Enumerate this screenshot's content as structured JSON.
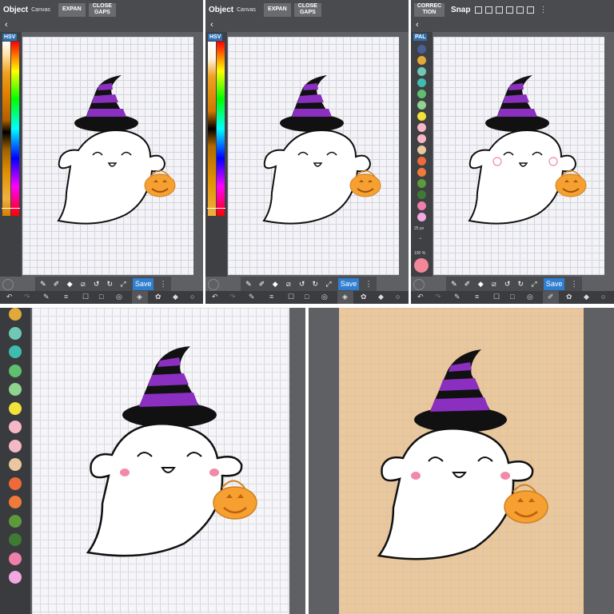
{
  "panels": [
    {
      "id": "panel-1",
      "topbar": {
        "mode": "Object",
        "sub": "Canvas",
        "btn1": "EXPAN",
        "btn2": "CLOSE GAPS"
      },
      "sidebar_tag": "HSV",
      "save_label": "Save"
    },
    {
      "id": "panel-2",
      "topbar": {
        "mode": "Object",
        "sub": "Canvas",
        "btn1": "EXPAN",
        "btn2": "CLOSE GAPS"
      },
      "sidebar_tag": "HSV",
      "save_label": "Save"
    },
    {
      "id": "panel-3",
      "topbar": {
        "mode": "CORREC TION",
        "snap": "Snap"
      },
      "sidebar_tag": "PAL",
      "brush_size": "25 px",
      "opacity": "100 %",
      "save_label": "Save"
    }
  ],
  "palette_colors": [
    "#e0a93a",
    "#6fc7b6",
    "#3fbcb0",
    "#5fbf6f",
    "#8fd38f",
    "#f2e23a",
    "#f4b8c6",
    "#f4b8c6",
    "#e9c7a0",
    "#ee6a3a",
    "#f07a3a",
    "#5c9a3a",
    "#3e7a34",
    "#f07eaa",
    "#f2a8e0"
  ],
  "palette_colors_small": [
    "#4b5e96",
    "#e0a93a",
    "#6fc7b6",
    "#3fbcb0",
    "#5fbf6f",
    "#8fd38f",
    "#f2e23a",
    "#f4b8c6",
    "#f4b8c6",
    "#e9c7a0",
    "#ee6a3a",
    "#f07a3a",
    "#5c9a3a",
    "#3e7a34",
    "#f07eaa",
    "#f2a8e0"
  ],
  "colors": {
    "hat_black": "#111111",
    "hat_purple": "#8a2fc0",
    "ghost_white": "#ffffff",
    "blush": "#f08aa8",
    "pumpkin": "#f5a030",
    "tan_background": "#ebc898",
    "accent_blue": "#2f7fd0"
  },
  "icons": [
    "back-arrow-icon",
    "eyedropper-icon",
    "pen-icon",
    "eraser-icon",
    "crop-icon",
    "undo-icon",
    "redo-icon",
    "transform-icon",
    "grid-icon",
    "layers-icon",
    "brush-icon",
    "fill-icon",
    "palette-icon",
    "menu-icon"
  ]
}
